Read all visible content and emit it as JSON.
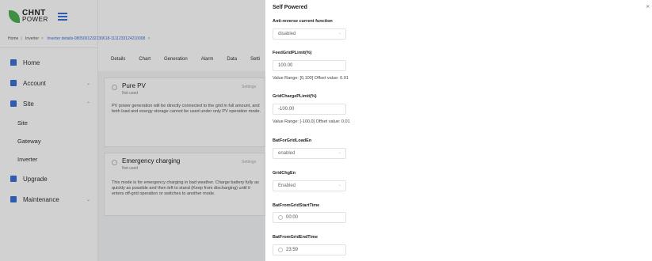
{
  "app": {
    "logo_line1": "CHNT",
    "logo_line2": "POWER",
    "breadcrumb": [
      "Home",
      "Inverter",
      "Inverter details-0805001232230618-1111233124210008"
    ],
    "nav": [
      {
        "label": "Home",
        "icon": "home-icon"
      },
      {
        "label": "Account",
        "icon": "account-icon"
      },
      {
        "label": "Site",
        "icon": "site-icon"
      },
      {
        "label": "Upgrade",
        "icon": "upgrade-icon"
      },
      {
        "label": "Maintenance",
        "icon": "maintenance-icon"
      }
    ],
    "sub_items": [
      "Site",
      "Gateway",
      "Inverter"
    ],
    "tabs": [
      "Details",
      "Chart",
      "Generation",
      "Alarm",
      "Data",
      "Setti"
    ],
    "cards": [
      {
        "title": "Pure PV",
        "status": "Not used",
        "setting": "Settings",
        "desc": "PV power generation will be directly connected to the grid in full amount, and both load and energy storage cannot be used under only PV operation mode."
      },
      {
        "title": "Emergency charging",
        "status": "Not used",
        "setting": "Settings",
        "desc": "This mode is for emergency charging in bad weather. Charge battery fully as quickly as possible and then left to stand (Keep from discharging) until it enters off-grid operation or switches to another mode."
      }
    ]
  },
  "drawer": {
    "title": "Self Powered",
    "close": "×",
    "fields": {
      "anti_reverse": {
        "label": "Anti-reverse current function",
        "value": "disabled"
      },
      "feed_grid": {
        "label": "FeedGridPLimit(%)",
        "value": "100.00",
        "hint": "Value Range: [0,100] Offset value: 0.01"
      },
      "grid_charge": {
        "label": "GridChargePLimit(%)",
        "value": "-100.00",
        "hint": "Value Range: [-100,0] Offset value: 0.01"
      },
      "bat_for_grid": {
        "label": "BatForGridLoadEn",
        "value": "enabled"
      },
      "grid_chg_en": {
        "label": "GridChgEn",
        "value": "Enabled"
      },
      "bat_start": {
        "label": "BatFromGridStartTime",
        "value": "00:00"
      },
      "bat_end": {
        "label": "BatFromGridEndTime",
        "value": "23:59"
      }
    }
  },
  "colors": {
    "accent": "#3a6fd8",
    "logo_green": "#4caf50",
    "overlay": "rgba(0,0,0,0.18)"
  }
}
